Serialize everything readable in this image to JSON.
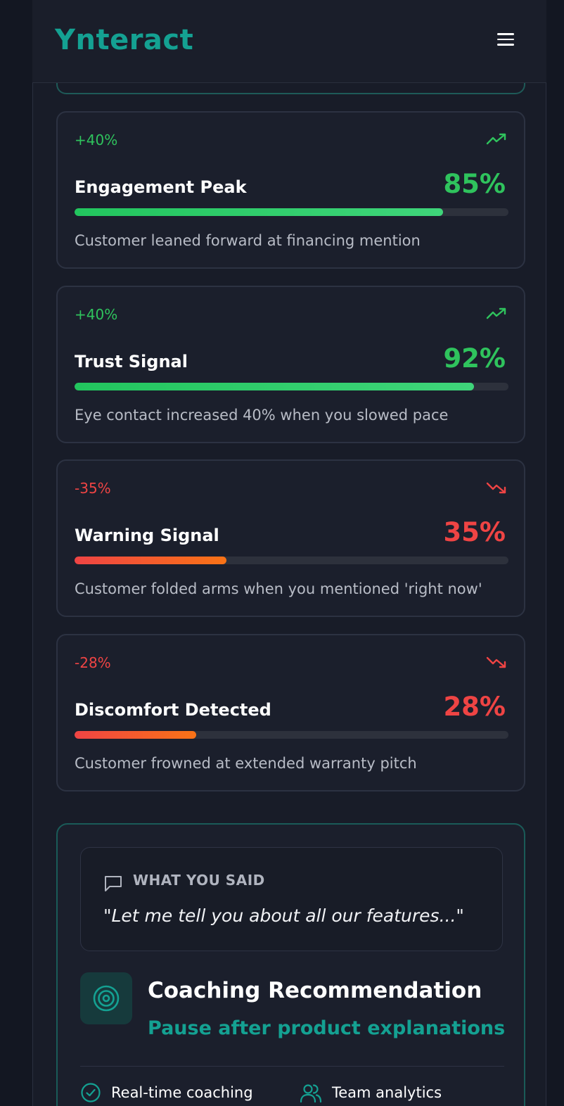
{
  "header": {
    "logo": "Ynteract",
    "menu_icon": "hamburger-menu-icon"
  },
  "colors": {
    "accent": "#14a192",
    "positive": "#2fc35d",
    "negative": "#ef4444",
    "background": "#131722",
    "card": "#1b1f2c"
  },
  "insights": [
    {
      "delta": "+40%",
      "trend": "trending-up-icon",
      "title": "Engagement Peak",
      "percent": "85%",
      "level": 0.85,
      "description": "Customer leaned forward at financing mention",
      "tone": "positive"
    },
    {
      "delta": "+40%",
      "trend": "trending-up-icon",
      "title": "Trust Signal",
      "percent": "92%",
      "level": 0.92,
      "description": "Eye contact increased 40% when you slowed pace",
      "tone": "positive"
    },
    {
      "delta": "-35%",
      "trend": "trending-down-icon",
      "title": "Warning Signal",
      "percent": "35%",
      "level": 0.35,
      "description": "Customer folded arms when you mentioned 'right now'",
      "tone": "negative"
    },
    {
      "delta": "-28%",
      "trend": "trending-down-icon",
      "title": "Discomfort Detected",
      "percent": "28%",
      "level": 0.28,
      "description": "Customer frowned at extended warranty pitch",
      "tone": "negative"
    }
  ],
  "coaching": {
    "said_label": "WHAT YOU SAID",
    "quote": "\"Let me tell you about all our features...\"",
    "title": "Coaching Recommendation",
    "recommendation": "Pause after product explanations",
    "features": [
      {
        "icon": "check-circle-icon",
        "label": "Real-time coaching"
      },
      {
        "icon": "users-icon",
        "label": "Team analytics"
      }
    ]
  }
}
